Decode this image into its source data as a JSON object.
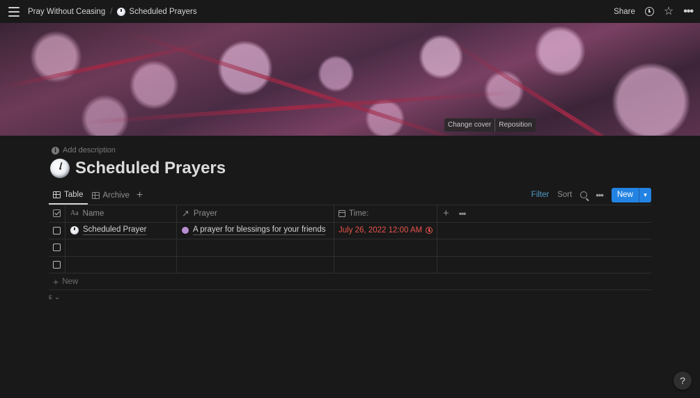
{
  "topbar": {
    "breadcrumb_parent": "Pray Without Ceasing",
    "breadcrumb_sep": "/",
    "breadcrumb_current": "Scheduled Prayers",
    "share_label": "Share"
  },
  "cover": {
    "change_cover_label": "Change cover",
    "reposition_label": "Reposition"
  },
  "page": {
    "add_description": "Add description",
    "title": "Scheduled Prayers"
  },
  "views": {
    "tabs": [
      {
        "label": "Table",
        "active": true
      },
      {
        "label": "Archive",
        "active": false
      }
    ],
    "add_view": "+",
    "filter_label": "Filter",
    "sort_label": "Sort",
    "new_label": "New"
  },
  "table": {
    "columns": [
      {
        "label": "Name",
        "icon": "text-property-icon"
      },
      {
        "label": "Prayer",
        "icon": "relation-arrow-icon"
      },
      {
        "label": "Time:",
        "icon": "calendar-icon"
      }
    ],
    "rows": [
      {
        "name": "Scheduled Prayer",
        "prayer": "A prayer for blessings for your friends",
        "time": "July 26, 2022 12:00 AM",
        "has_reminder": true
      },
      {
        "name": "",
        "prayer": "",
        "time": "",
        "has_reminder": false
      },
      {
        "name": "",
        "prayer": "",
        "time": "",
        "has_reminder": false
      }
    ],
    "new_row_label": "New",
    "calculate_label": "ᴇ"
  },
  "help_label": "?",
  "colors": {
    "background": "#191919",
    "accent_blue": "#2383e2",
    "filter_blue": "#529cca",
    "date_red": "#e8534b",
    "prayer_dot": "#b88ed3"
  }
}
